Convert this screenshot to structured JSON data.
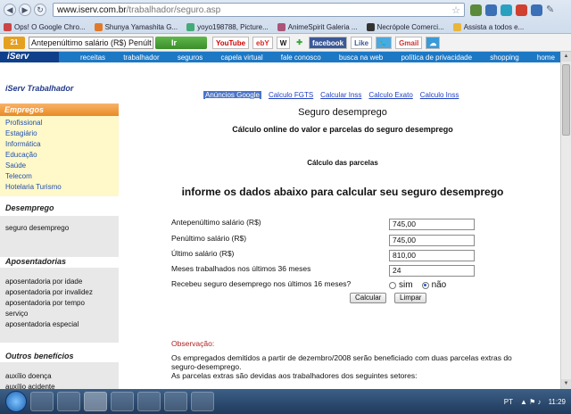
{
  "browser": {
    "url_host": "www.iserv.com.br",
    "url_path": "/trabalhador/seguro.asp",
    "bookmarks": [
      "Ops! O Google Chro...",
      "Shunya Yamashita G...",
      "yoyo198788, Picture...",
      "AnimeSpirit Galeria ...",
      "Necrópole Comerci...",
      "Assista a todos e..."
    ]
  },
  "toolbar": {
    "search_value": "Antepenúltimo salário (R$)  Penúlt",
    "go_label": "Ir",
    "brands": [
      "YouTube",
      "ebY",
      "W",
      "facebook",
      "Like",
      "Gmail"
    ]
  },
  "site": {
    "logo": "iServ",
    "nav": [
      "receitas",
      "trabalhador",
      "seguros",
      "capela virtual",
      "fale conosco",
      "busca na web",
      "política de privacidade",
      "shopping",
      "home"
    ]
  },
  "sidebar": {
    "title": "iServ Trabalhador",
    "empregos_label": "Empregos",
    "empregos_items": [
      "Profissional",
      "Estagiário",
      "Informática",
      "Educação",
      "Saúde",
      "Telecom",
      "Hotelaria Turismo"
    ],
    "desemprego_label": "Desemprego",
    "desemprego_items": [
      "seguro desemprego"
    ],
    "aposentadorias_label": "Aposentadorias",
    "aposentadorias_items": [
      "aposentadoria por idade",
      "aposentadoria por invalidez",
      "aposentadoria por tempo",
      "serviço",
      "aposentadoria especial"
    ],
    "outros_label": "Outros benefícios",
    "outros_items": [
      "auxílio doença",
      "auxílio acidente"
    ]
  },
  "main": {
    "tabs": [
      "Anúncios Google",
      "Calculo FGTS",
      "Calcular Inss",
      "Calculo Exato",
      "Calculo Inss"
    ],
    "title": "Seguro desemprego",
    "subtitle": "Cálculo online do valor e parcelas do seguro desemprego",
    "calc_head": "Cálculo das parcelas",
    "big_head": "informe os dados abaixo para calcular seu seguro desemprego",
    "fields": [
      {
        "label": "Antepenúltimo salário (R$)",
        "value": "745,00"
      },
      {
        "label": "Penúltimo salário (R$)",
        "value": "745,00"
      },
      {
        "label": "Último salário (R$)",
        "value": "810,00"
      },
      {
        "label": "Meses trabalhados nos últimos 36 meses",
        "value": "24"
      }
    ],
    "question": "Recebeu seguro desemprego nos últimos 16 meses?",
    "radio_yes": "sim",
    "radio_no": "não",
    "calc_button": "Calcular",
    "clear_button": "Limpar",
    "obs_head": "Observação:",
    "obs_line1": "Os empregados demitidos a partir de dezembro/2008 serão beneficiado com duas parcelas extras do seguro-desemprego.",
    "obs_line2": "As parcelas extras são devidas aos trabalhadores dos seguintes setores:"
  },
  "taskbar": {
    "lang": "PT",
    "clock": "11:29"
  }
}
